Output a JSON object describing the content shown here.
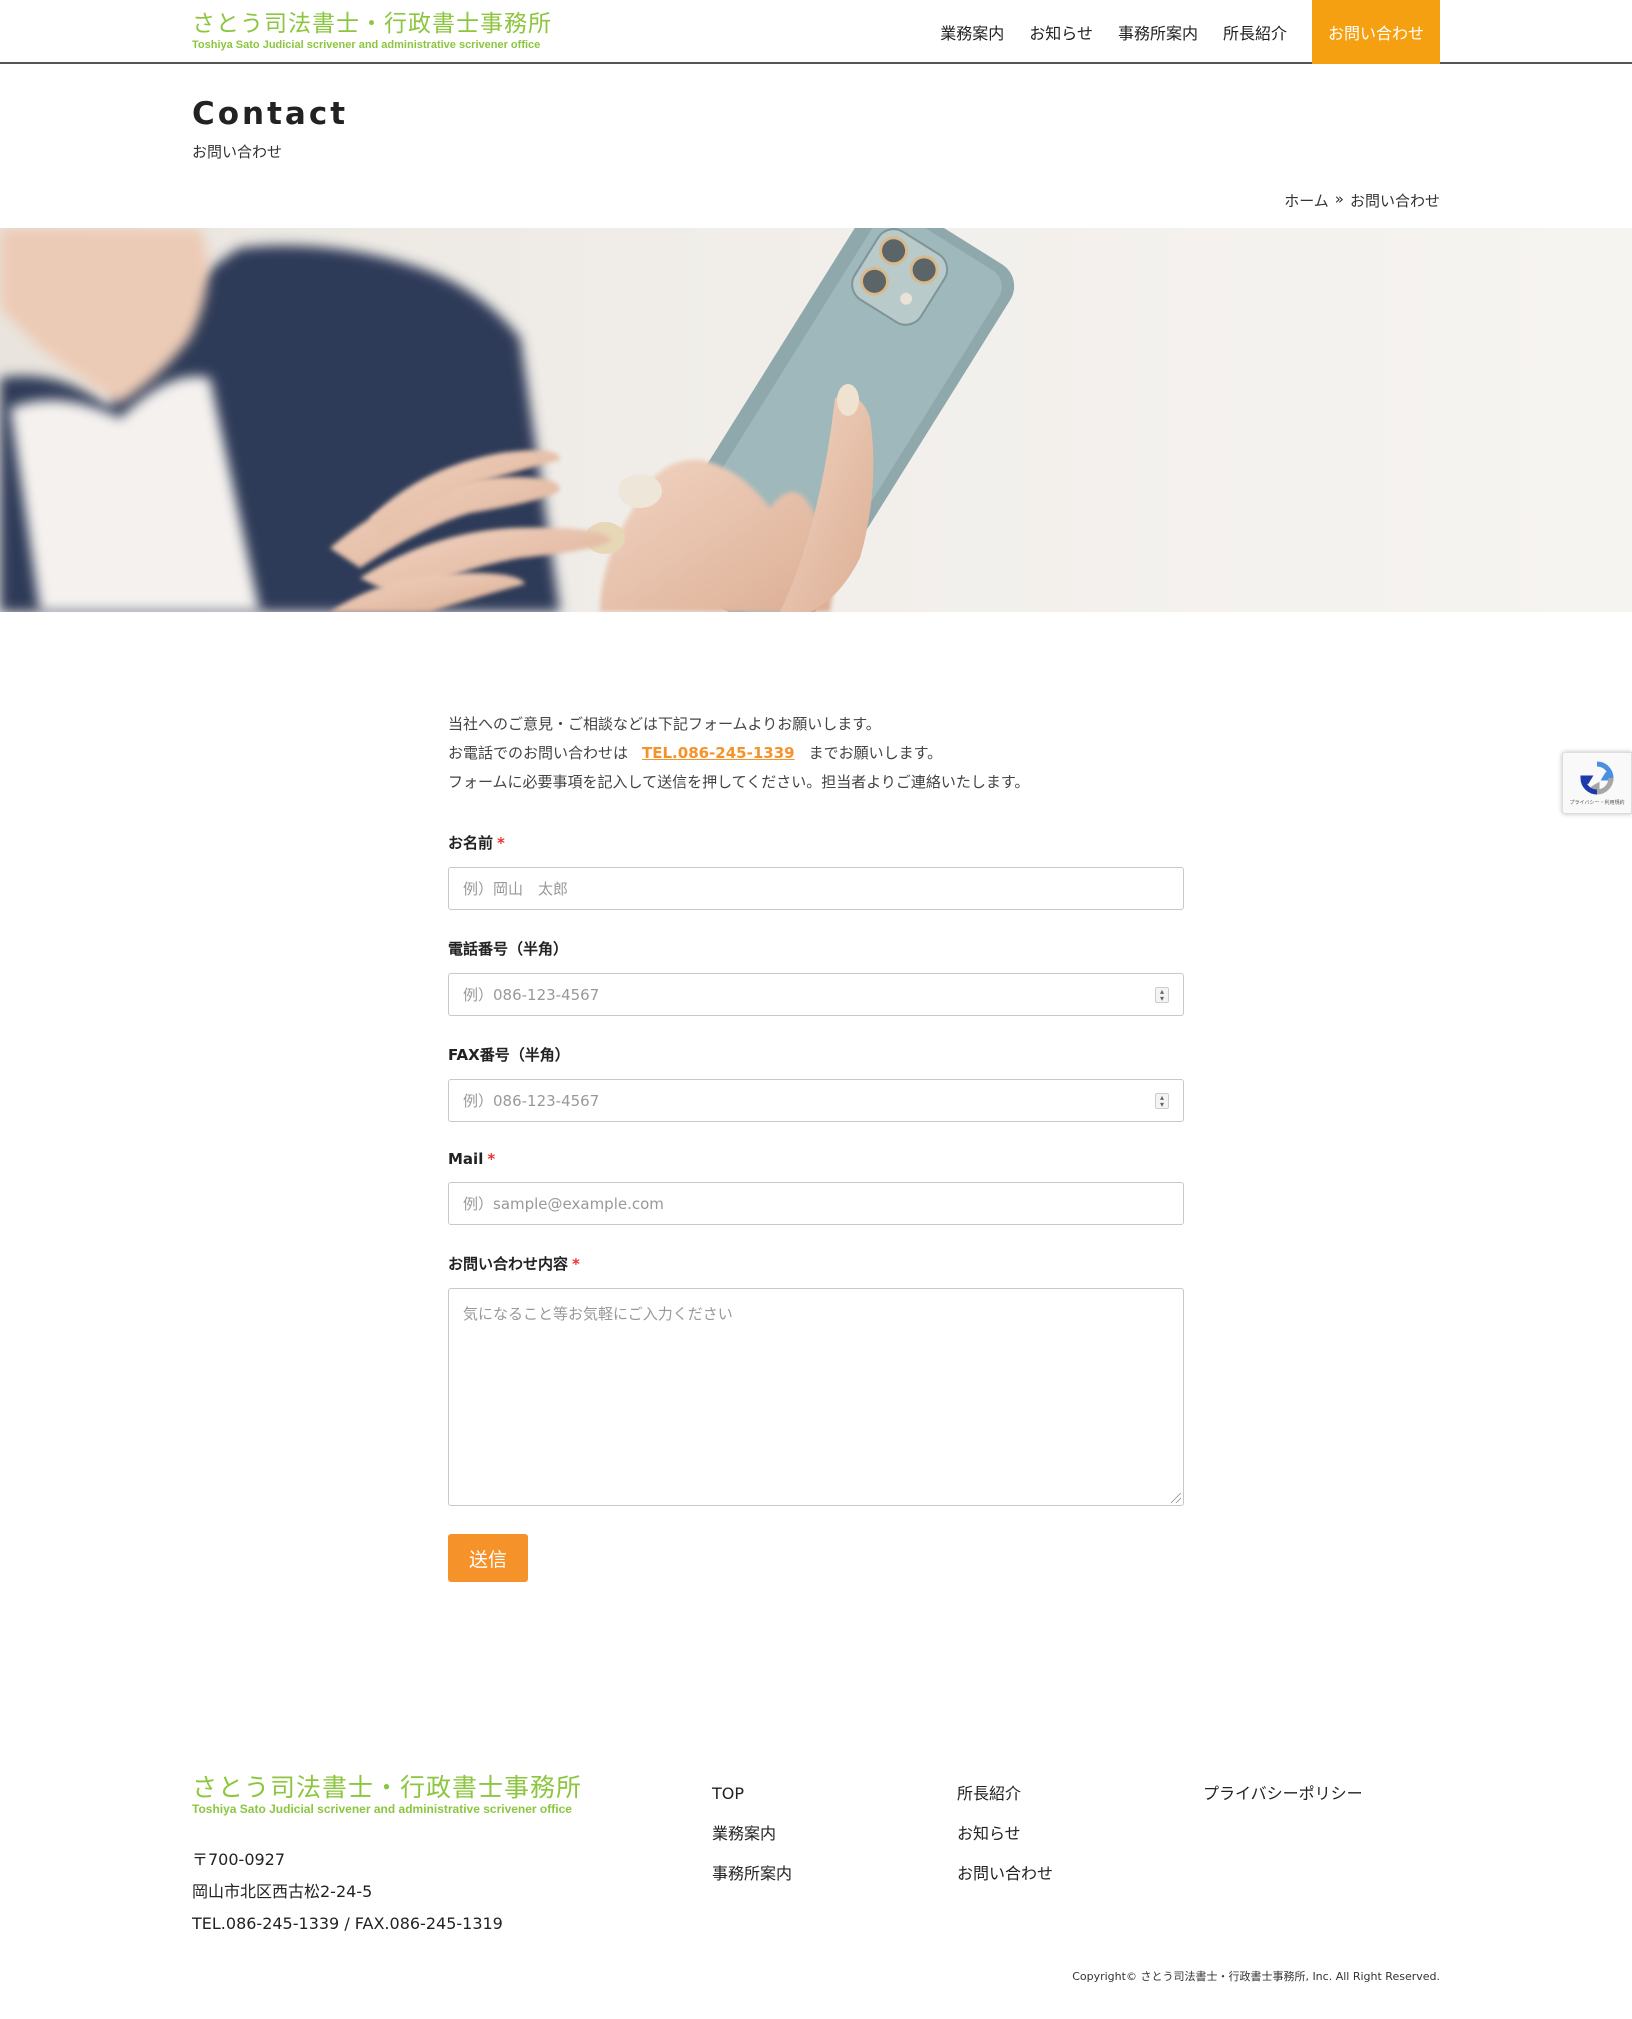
{
  "header": {
    "logo_jp": "さとう司法書士・行政書士事務所",
    "logo_en": "Toshiya Sato Judicial scrivener and administrative scrivener office",
    "nav": [
      "業務案内",
      "お知らせ",
      "事務所案内",
      "所長紹介"
    ],
    "cta": "お問い合わせ"
  },
  "page": {
    "title": "Contact",
    "subtitle": "お問い合わせ",
    "breadcrumb_home": "ホーム",
    "breadcrumb_sep": "»",
    "breadcrumb_current": "お問い合わせ"
  },
  "intro": {
    "line1": "当社へのご意見・ご相談などは下記フォームよりお願いします。",
    "line2_pre": "お電話でのお問い合わせは",
    "line2_tel": "TEL.086-245-1339",
    "line2_post": "までお願いします。",
    "line3": "フォームに必要事項を記入して送信を押してください。担当者よりご連絡いたします。"
  },
  "form": {
    "required_mark": "*",
    "name_label": "お名前",
    "name_placeholder": "例）岡山　太郎",
    "phone_label": "電話番号（半角）",
    "phone_placeholder": "例）086-123-4567",
    "fax_label": "FAX番号（半角）",
    "fax_placeholder": "例）086-123-4567",
    "mail_label": "Mail",
    "mail_placeholder": "例）sample@example.com",
    "message_label": "お問い合わせ内容",
    "message_placeholder": "気になること等お気軽にご入力ください",
    "submit": "送信"
  },
  "recaptcha": {
    "text": "プライバシー・利用規約"
  },
  "footer": {
    "logo_jp": "さとう司法書士・行政書士事務所",
    "logo_en": "Toshiya Sato Judicial scrivener and administrative scrivener office",
    "postal": "〒700-0927",
    "address": "岡山市北区西古松2-24-5",
    "tel_fax": "TEL.086-245-1339 / FAX.086-245-1319",
    "col1": [
      "TOP",
      "業務案内",
      "事務所案内"
    ],
    "col2": [
      "所長紹介",
      "お知らせ",
      "お問い合わせ"
    ],
    "col3": [
      "プライバシーポリシー"
    ],
    "copyright": "Copyright© さとう司法書士・行政書士事務所, Inc. All Right Reserved."
  },
  "colors": {
    "brand_green": "#8cc63f",
    "accent_orange": "#f5a011",
    "button_orange": "#f5922a",
    "required_red": "#e33333"
  }
}
